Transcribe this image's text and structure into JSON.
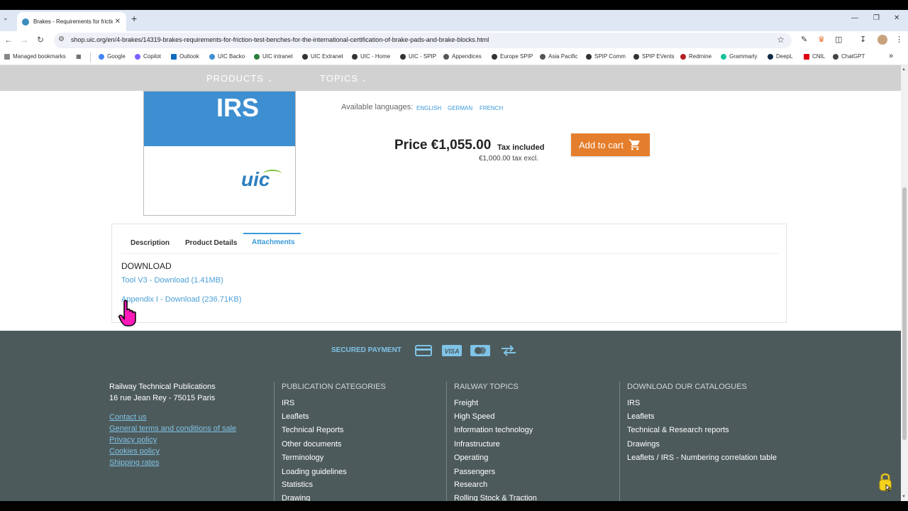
{
  "browser": {
    "tab_title": "Brakes - Requirements for friction",
    "tab_close": "✕",
    "new_tab": "+",
    "url": "shop.uic.org/en/4-brakes/14319-brakes-requirements-for-friction-test-benches-for-the-international-certification-of-brake-pads-and-brake-blocks.html",
    "bookmarks": [
      "Managed bookmarks",
      "Google",
      "Copilot",
      "Outlook",
      "UIC Backo",
      "UIC intranet",
      "UIC Extranet",
      "UIC - Home",
      "UIC - SPIP",
      "Appendices",
      "Europe SPIP",
      "Asia Pacific",
      "SPIP Comm",
      "SPIP EVents",
      "Redmine",
      "Grammarly",
      "DeepL",
      "CNIL",
      "ChatGPT"
    ],
    "bookmarks_more": "»"
  },
  "nav": {
    "products": "PRODUCTS",
    "topics": "TOPICS"
  },
  "product": {
    "image_title": "IRS",
    "image_logo": "uic",
    "languages_label": "Available languages:",
    "languages": [
      "ENGLISH",
      "GERMAN",
      "FRENCH"
    ],
    "price": "Price €1,055.00",
    "tax_included": "Tax included",
    "price_excl": "€1,000.00 tax excl.",
    "add_to_cart": "Add to cart"
  },
  "tabs": {
    "items": [
      "Description",
      "Product Details",
      "Attachments"
    ],
    "active": 2
  },
  "attachments": {
    "heading": "DOWNLOAD",
    "links": [
      "Tool V3 - Download (1.41MB)",
      "Appendix I - Download (236.71KB)"
    ]
  },
  "footer": {
    "secured_payment": "SECURED PAYMENT",
    "company": "Railway Technical Publications",
    "address": "16 rue Jean Rey - 75015 Paris",
    "links": [
      "Contact us",
      "General terms and conditions of sale",
      "Privacy policy",
      "Cookies policy",
      "Shipping rates"
    ],
    "columns": [
      {
        "title": "PUBLICATION CATEGORIES",
        "items": [
          "IRS",
          "Leaflets",
          "Technical Reports",
          "Other documents",
          "Terminology",
          "Loading guidelines",
          "Statistics",
          "Drawing"
        ]
      },
      {
        "title": "RAILWAY TOPICS",
        "items": [
          "Freight",
          "High Speed",
          "Information technology",
          "Infrastructure",
          "Operating",
          "Passengers",
          "Research",
          "Rolling Stock & Traction"
        ]
      },
      {
        "title": "DOWNLOAD OUR CATALOGUES",
        "items": [
          "IRS",
          "Leaflets",
          "Technical & Research reports",
          "Drawings",
          "Leaflets / IRS - Numbering correlation table"
        ]
      }
    ]
  },
  "colors": {
    "accent_blue": "#3a9ad9",
    "cart_orange": "#e57e2c",
    "footer_bg": "#4d5a5b"
  }
}
